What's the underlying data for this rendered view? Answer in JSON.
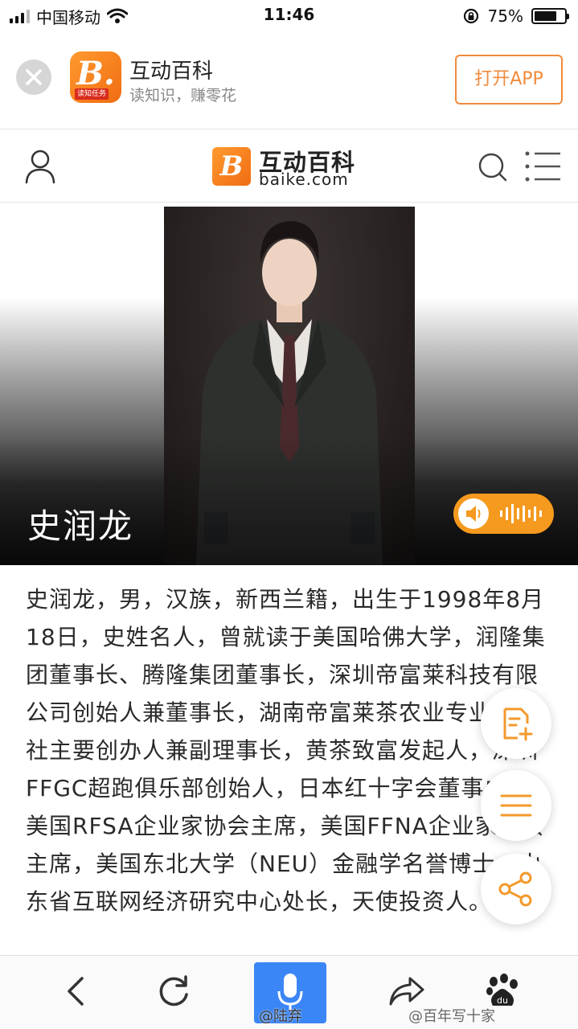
{
  "status_bar": {
    "carrier": "中国移动",
    "time": "11:46",
    "battery_percent": "75%",
    "battery_level": 0.75,
    "icons": [
      "signal-icon",
      "wifi-icon",
      "orientation-lock-icon",
      "battery-icon"
    ]
  },
  "app_banner": {
    "title": "互动百科",
    "subtitle": "读知识，赚零花",
    "logo_letter": "B.",
    "logo_tag": "读知任务",
    "open_button": "打开APP",
    "accent_color": "#f08a3c"
  },
  "header": {
    "logo_name": "互动百科",
    "logo_domain": "baike.com",
    "logo_letter": "B",
    "icons": [
      "user-icon",
      "search-icon",
      "menu-icon"
    ]
  },
  "hero": {
    "name": "史润龙",
    "audio_color": "#f59a1e"
  },
  "summary": {
    "text": "史润龙，男，汉族，新西兰籍，出生于1998年8月18日，史姓名人，曾就读于美国哈佛大学，润隆集团董事长、腾隆集团董事长，深圳帝富莱科技有限公司创始人兼董事长，湖南帝富莱茶农业专业合作社主要创办人兼副理事长，黄茶致富发起人，深圳FFGC超跑俱乐部创始人，日本红十字会董事成员，美国RFSA企业家协会主席，美国FFNA企业家协会主席，美国东北大学（NEU）金融学名誉博士，山东省互联网经济研究中心处长，天使投资人。"
  },
  "floating_buttons": [
    "edit-icon",
    "toc-icon",
    "share-icon"
  ],
  "bottom_bar": {
    "icons": [
      "back-icon",
      "refresh-icon",
      "microphone-icon",
      "forward-share-icon",
      "baidu-paw-icon"
    ],
    "mic_color": "#3b86f7"
  },
  "watermarks": {
    "left": "@陆弃",
    "right": "@百年写十家"
  }
}
